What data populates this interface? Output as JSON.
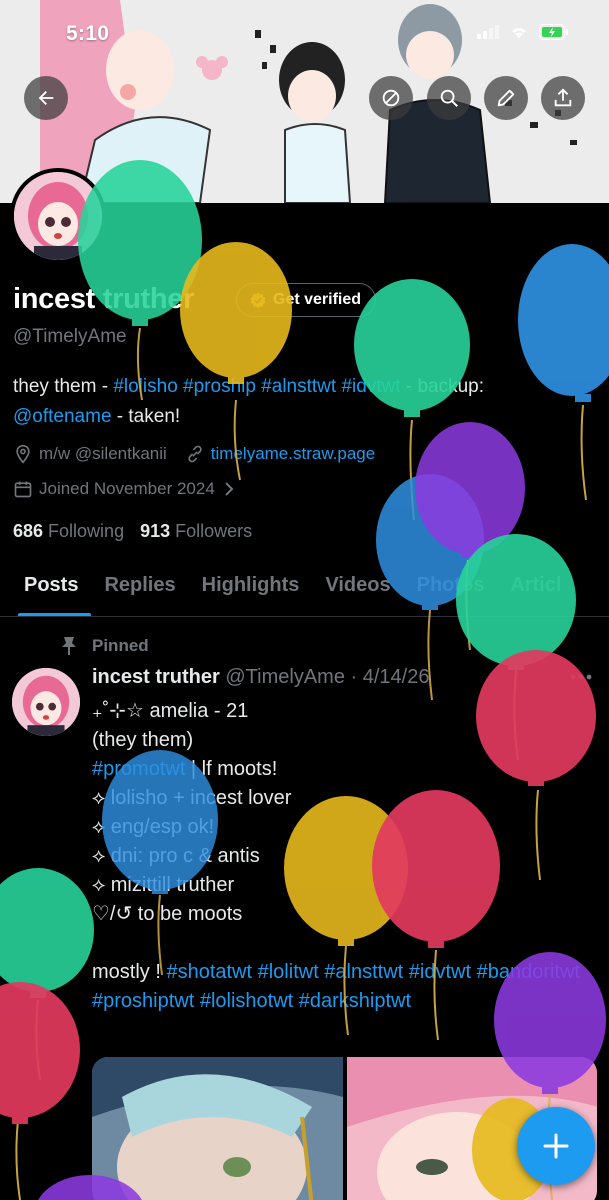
{
  "status_bar": {
    "time": "5:10"
  },
  "header": {
    "back_icon": "arrow-left-icon",
    "actions": [
      "ban-icon",
      "search-icon",
      "pencil-icon",
      "share-icon"
    ]
  },
  "profile": {
    "display_name": "incest truther",
    "verify_label": "Get verified",
    "handle": "@TimelyAme",
    "bio_pre": "they them - ",
    "bio_tags": "#lolisho #proship #alnsttwt #idvtwt",
    "bio_mid": " - backup: ",
    "bio_backup": "@oftename",
    "bio_post": " - taken!",
    "location": "m/w @silentkanii",
    "website": "timelyame.straw.page",
    "joined": "Joined November 2024",
    "following_count": "686",
    "following_label": "Following",
    "followers_count": "913",
    "followers_label": "Followers"
  },
  "tabs": [
    "Posts",
    "Replies",
    "Highlights",
    "Videos",
    "Photos",
    "Articl"
  ],
  "pinned_post": {
    "pinned_label": "Pinned",
    "author_name": "incest truther",
    "author_handle": "@TimelyAme",
    "separator": " · ",
    "date": "4/14/26",
    "line1": "₊˚⊹☆ amelia - 21",
    "line2": "(they them)",
    "line3_tag": "#promotwt",
    "line3_rest": " | lf moots!",
    "line4": "⟡ lolisho + incest lover",
    "line5": "⟡ eng/esp ok!",
    "line6": "⟡ dni: pro c & antis",
    "line7": "⟡ mizittill truther",
    "line8": "♡/↺ to be moots",
    "tags_prefix": "mostly ! ",
    "tags": "#shotatwt #lolitwt #alnsttwt #idvtwt #bandoritwt #proshiptwt #lolishotwt #darkshiptwt"
  },
  "colors": {
    "accent": "#1d9bf0",
    "background": "#000000",
    "muted": "#71767b"
  }
}
